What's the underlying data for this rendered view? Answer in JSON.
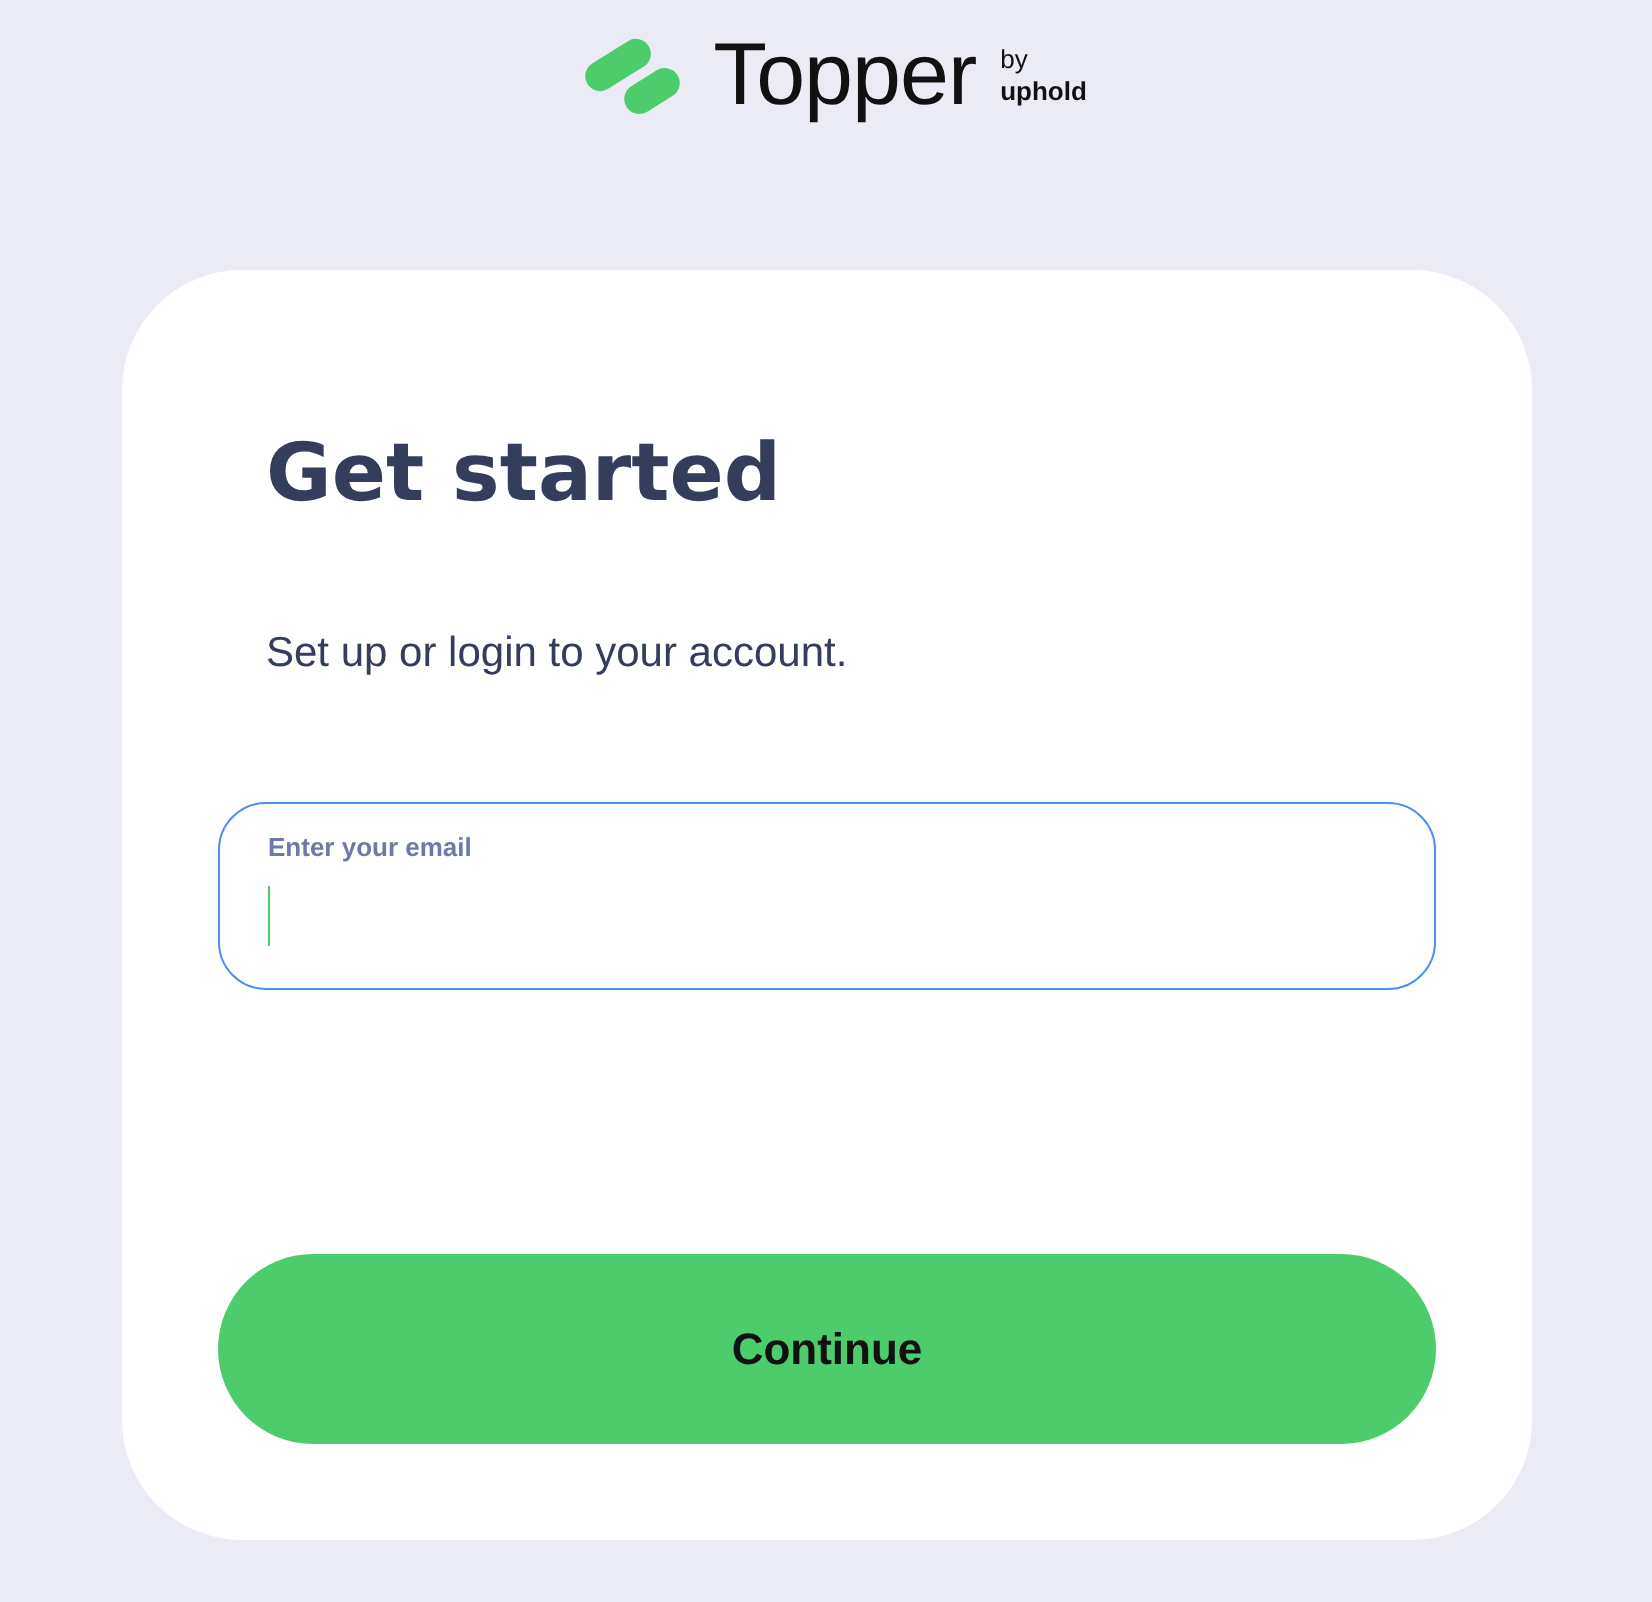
{
  "header": {
    "brand": "Topper",
    "by": "by",
    "parent": "uphold"
  },
  "card": {
    "title": "Get started",
    "subtitle": "Set up or login to your account.",
    "email_field": {
      "label": "Enter your email",
      "focused": true
    },
    "continue_button": {
      "label": "Continue"
    }
  }
}
